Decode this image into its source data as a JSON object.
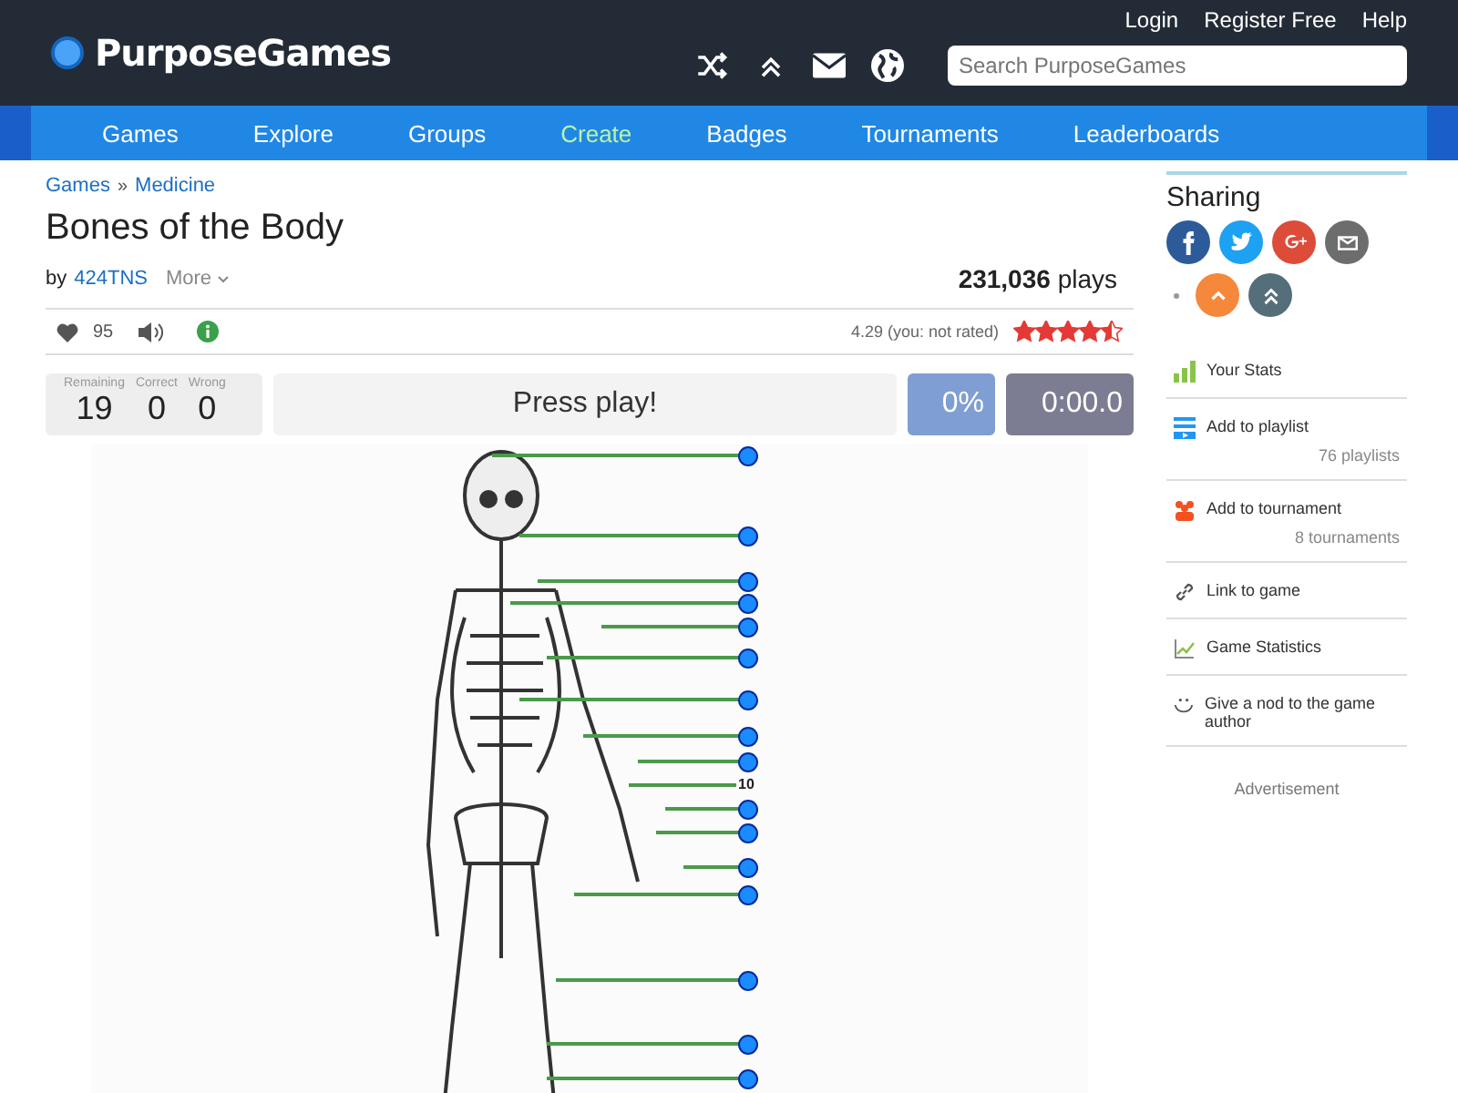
{
  "header": {
    "logo": "PurposeGames",
    "links": [
      "Login",
      "Register Free",
      "Help"
    ],
    "search": {
      "placeholder": "Search PurposeGames"
    }
  },
  "nav": [
    {
      "label": "Games",
      "selected": false
    },
    {
      "label": "Explore",
      "selected": false
    },
    {
      "label": "Groups",
      "selected": false
    },
    {
      "label": "Create",
      "selected": true
    },
    {
      "label": "Badges",
      "selected": false
    },
    {
      "label": "Tournaments",
      "selected": false
    },
    {
      "label": "Leaderboards",
      "selected": false
    }
  ],
  "breadcrumb": {
    "links": [
      "Games",
      "Medicine"
    ],
    "separator": "»"
  },
  "game": {
    "title": "Bones of the Body",
    "by": "by",
    "author": "424TNS",
    "more": "More",
    "plays_count": "231,036",
    "plays_label": "plays",
    "likes": "95",
    "rating": "4.29 (you: not rated)",
    "stars": 4.5
  },
  "scoreboard": {
    "stats": [
      {
        "label": "Remaining",
        "value": "19"
      },
      {
        "label": "Correct",
        "value": "0"
      },
      {
        "label": "Wrong",
        "value": "0"
      }
    ],
    "prompt": "Press play!",
    "percent": "0%",
    "timer": "0:00.0"
  },
  "markers": [
    {
      "kind": "dot"
    },
    {
      "kind": "dot"
    },
    {
      "kind": "dot"
    },
    {
      "kind": "dot"
    },
    {
      "kind": "dot"
    },
    {
      "kind": "dot"
    },
    {
      "kind": "dot"
    },
    {
      "kind": "dot"
    },
    {
      "kind": "dot"
    },
    {
      "kind": "label",
      "text": "10"
    },
    {
      "kind": "dot"
    },
    {
      "kind": "dot"
    },
    {
      "kind": "dot"
    },
    {
      "kind": "dot"
    },
    {
      "kind": "dot"
    },
    {
      "kind": "dot"
    },
    {
      "kind": "dot"
    }
  ],
  "sidebar": {
    "title": "Sharing",
    "share": [
      {
        "kind": "facebook",
        "color": "#2d5b9a"
      },
      {
        "kind": "twitter",
        "color": "#1da1f2"
      },
      {
        "kind": "google",
        "color": "#dd4b39"
      },
      {
        "kind": "email",
        "color": "#6d6d6d"
      },
      {
        "kind": "up",
        "color": "#f5883a"
      },
      {
        "kind": "double-up",
        "color": "#546e7a"
      }
    ],
    "items": [
      {
        "kind": "stats",
        "label": "Your Stats"
      },
      {
        "kind": "playlist",
        "label": "Add to playlist",
        "count": "76 playlists"
      },
      {
        "kind": "tournament",
        "label": "Add to tournament",
        "count": "8 tournaments"
      },
      {
        "kind": "link",
        "label": "Link to game"
      },
      {
        "kind": "chart",
        "label": "Game Statistics"
      },
      {
        "kind": "smile",
        "label": "Give a nod to the game author"
      }
    ],
    "ad": "Advertisement"
  }
}
